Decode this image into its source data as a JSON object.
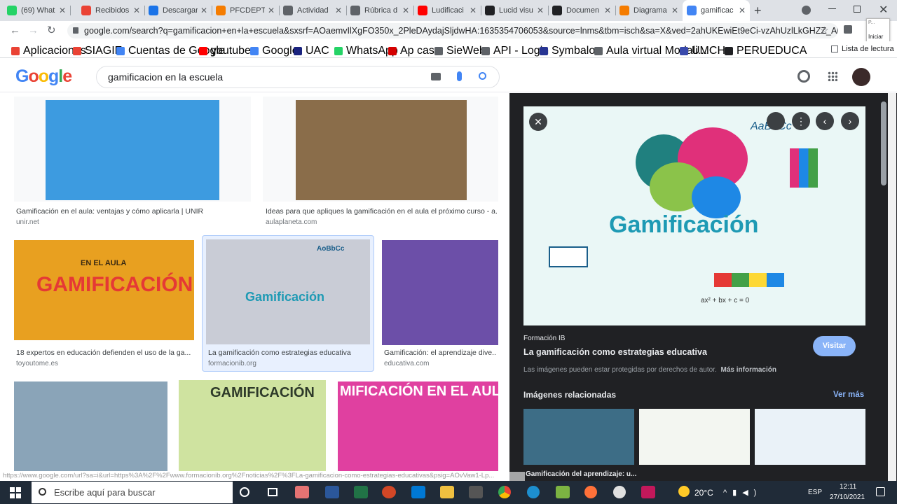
{
  "tabs": [
    {
      "label": "(69) What",
      "color": "#25d366"
    },
    {
      "label": "Recibidos",
      "color": "#ea4335"
    },
    {
      "label": "Descargar",
      "color": "#1a73e8"
    },
    {
      "label": "PFCDEPT",
      "color": "#f57c00"
    },
    {
      "label": "Actividad",
      "color": "#5f6368"
    },
    {
      "label": "Rúbrica d",
      "color": "#5f6368"
    },
    {
      "label": "Ludificaci",
      "color": "#ff0000"
    },
    {
      "label": "Lucid visu",
      "color": "#202124"
    },
    {
      "label": "Documen",
      "color": "#202124"
    },
    {
      "label": "Diagrama",
      "color": "#f57c00"
    },
    {
      "label": "gamificac",
      "color": "#4285f4"
    }
  ],
  "address": "google.com/search?q=gamificacion+en+la+escuela&sxsrf=AOaemvIlXgFO350x_2PleDAydajSljdwHA:1635354706053&source=lnms&tbm=isch&sa=X&ved=2ahUKEwiEt9eCi-vzAhUzlLkGHZZ_AMIQ_AU...",
  "bookmarks": [
    {
      "label": "Aplicaciones",
      "color": "#ea4335"
    },
    {
      "label": "SIAGIE",
      "color": "#ea4335"
    },
    {
      "label": "Cuentas de Google",
      "color": "#4285f4"
    },
    {
      "label": "youtube",
      "color": "#ff0000"
    },
    {
      "label": "Google",
      "color": "#4285f4"
    },
    {
      "label": "UAC",
      "color": "#1a237e"
    },
    {
      "label": "WhatsApp",
      "color": "#25d366"
    },
    {
      "label": "Ap casa",
      "color": "#d50000"
    },
    {
      "label": "SieWeb",
      "color": "#5f6368"
    },
    {
      "label": "API - Login",
      "color": "#5f6368"
    },
    {
      "label": "Symbaloo",
      "color": "#283593"
    },
    {
      "label": "Aula virtual Modali...",
      "color": "#5f6368"
    },
    {
      "label": "UMCH",
      "color": "#3949ab"
    },
    {
      "label": "PERUEDUCA",
      "color": "#202124"
    }
  ],
  "reading_list": "Lista de lectura",
  "iniciar": "Iniciar",
  "logo": "Google",
  "search_query": "gamificacion en la escuela",
  "results": [
    {
      "caption": "Gamificación en el aula: ventajas y cómo aplicarla | UNIR",
      "source": "unir.net",
      "color": "#3d9be0"
    },
    {
      "caption": "Ideas para que apliques la gamificación en el aula el próximo curso - a...",
      "source": "aulaplaneta.com",
      "color": "#8a6d4a"
    },
    {
      "caption": "18 expertos en educación defienden el uso de la ga...",
      "source": "toyoutome.es",
      "color": "#e8a020"
    },
    {
      "caption": "La gamificación como estrategias educativa",
      "source": "formacionib.org",
      "color": "#c9ccd6"
    },
    {
      "caption": "Gamificación: el aprendizaje dive...",
      "source": "educativa.com",
      "color": "#6c4fa8"
    },
    {
      "caption": "",
      "source": "",
      "color": "#8aa4b8"
    },
    {
      "caption": "",
      "source": "",
      "color": "#cfe3a0"
    },
    {
      "caption": "",
      "source": "",
      "color": "#e040a0"
    }
  ],
  "thumb_texts": {
    "r3": "EN EL AULA",
    "r3b": "GAMIFICACIÓN",
    "r4": "AoBbCc",
    "r4b": "Gamificación",
    "r7": "GAMIFICACIÓN",
    "r8": "MIFICACIÓN EN EL AULA"
  },
  "panel": {
    "image_title": "Gamificación",
    "image_abc": "AaBbCc",
    "formula": "ax² + bx + c = 0",
    "site": "Formación IB",
    "title": "La gamificación como estrategias educativa",
    "visit": "Visitar",
    "copyright": "Las imágenes pueden estar protegidas por derechos de autor.",
    "more_info": "Más información",
    "related_heading": "Imágenes relacionadas",
    "see_more": "Ver más",
    "related_caption": "Gamificación del aprendizaje: u..."
  },
  "status_url": "https://www.google.com/url?sa=i&url=https%3A%2F%2Fwww.formacionib.org%2Fnoticias%2F%3FLa-gamificacion-como-estrategias-educativas&psig=AOvVaw1-Lp...",
  "taskbar": {
    "search_placeholder": "Escribe aquí para buscar",
    "temp": "20°C",
    "lang": "ESP",
    "time": "12:11",
    "date": "27/10/2021"
  }
}
